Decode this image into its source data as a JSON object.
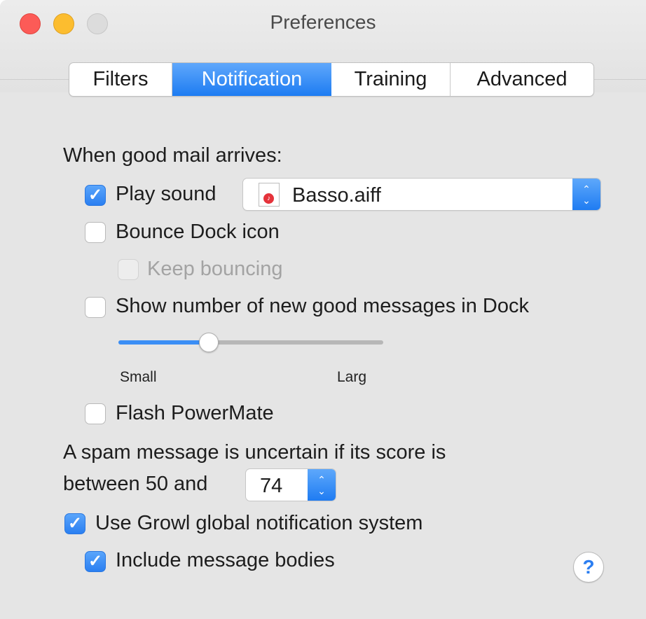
{
  "window": {
    "title": "Preferences"
  },
  "tabs": [
    {
      "label": "Filters",
      "active": false
    },
    {
      "label": "Notification",
      "active": true
    },
    {
      "label": "Training",
      "active": false
    },
    {
      "label": "Advanced",
      "active": false
    }
  ],
  "good_mail": {
    "heading": "When good mail arrives:",
    "play_sound": {
      "label": "Play sound",
      "checked": true
    },
    "sound_popup": {
      "value": "Basso.aiff",
      "icon": "audio-file-icon"
    },
    "bounce_dock": {
      "label": "Bounce Dock icon",
      "checked": false
    },
    "keep_bouncing": {
      "label": "Keep bouncing",
      "checked": false,
      "enabled": false
    },
    "show_number": {
      "label": "Show number of new good messages in Dock",
      "checked": false
    },
    "size_slider": {
      "min_label": "Small",
      "max_label": "Larg",
      "level": 0.34
    },
    "flash_powermate": {
      "label": "Flash PowerMate",
      "checked": false
    }
  },
  "spam": {
    "line1": "A spam message is uncertain if its score is",
    "line2": "between 50 and",
    "upper_value": "74"
  },
  "growl": {
    "use_growl": {
      "label": "Use Growl global notification system",
      "checked": true
    },
    "include_bodies": {
      "label": "Include message bodies",
      "checked": true
    }
  },
  "help": {
    "glyph": "?"
  },
  "checkmark": "✓",
  "arrows": {
    "up": "⌃",
    "down": "⌄"
  },
  "colors": {
    "accent": "#1d7cf2",
    "close": "#fc5b57",
    "minimize": "#fcbd2f"
  }
}
